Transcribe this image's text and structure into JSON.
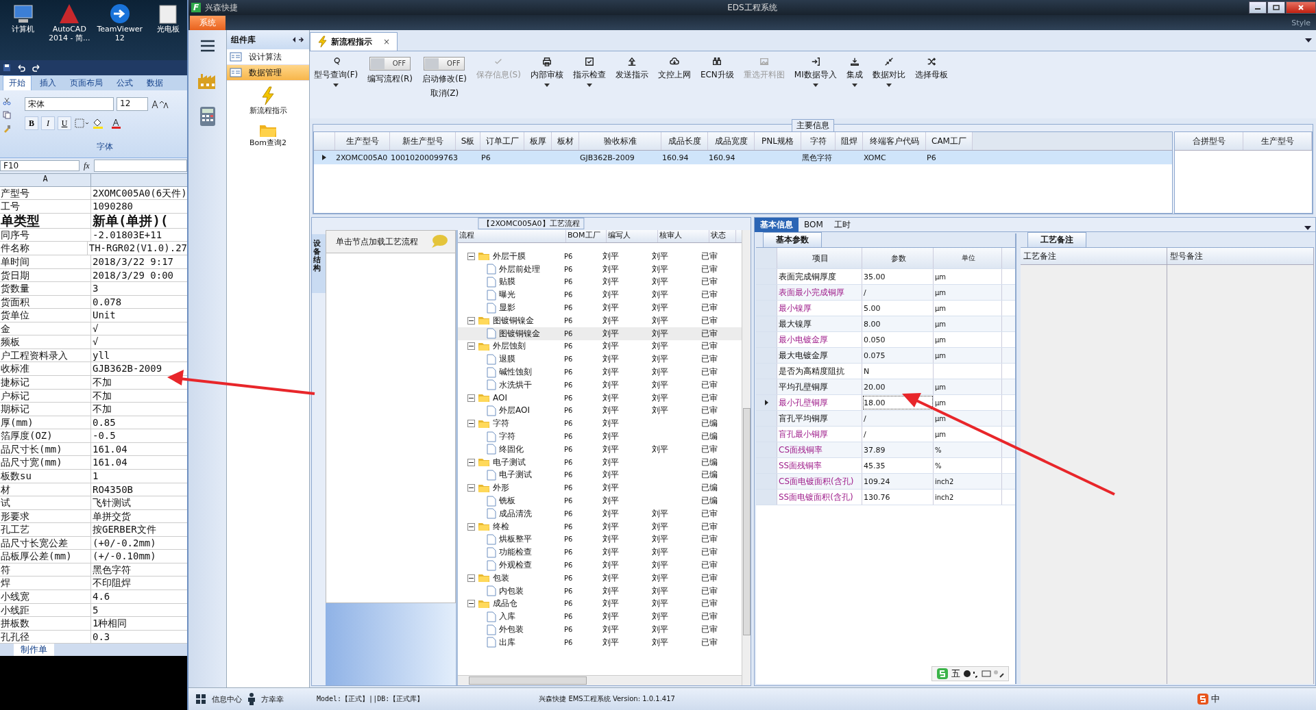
{
  "desktop": {
    "icons": [
      {
        "lines": [
          "计算机"
        ]
      },
      {
        "lines": [
          "AutoCAD",
          "2014 - 简..."
        ]
      },
      {
        "lines": [
          "TeamViewer",
          "12"
        ]
      },
      {
        "lines": [
          "光电板"
        ]
      }
    ]
  },
  "excel": {
    "tabs": [
      {
        "label": "开始",
        "selected": true
      },
      {
        "label": "插入",
        "selected": false
      },
      {
        "label": "页面布局",
        "selected": false
      },
      {
        "label": "公式",
        "selected": false
      },
      {
        "label": "数据",
        "selected": false
      }
    ],
    "font_name": "宋体",
    "font_size": "12",
    "format_buttons": [
      "B",
      "I",
      "U"
    ],
    "group_label": "字体",
    "name_box": "F10",
    "fx": "fx",
    "column": "A",
    "rows": [
      {
        "label": "产型号",
        "value": "2XOMC005A0(6天件)",
        "bold": false
      },
      {
        "label": "工号",
        "value": "1090280",
        "bold": false
      },
      {
        "label": "单类型",
        "value": "新单(单拼)(",
        "bold": true
      },
      {
        "label": "同序号",
        "value": "-2.01803E+11",
        "bold": false
      },
      {
        "label": "件名称",
        "value": "TH-RGR02(V1.0).27",
        "bold": false
      },
      {
        "label": "单时间",
        "value": "2018/3/22 9:17",
        "bold": false
      },
      {
        "label": "货日期",
        "value": "2018/3/29 0:00",
        "bold": false
      },
      {
        "label": "货数量",
        "value": "3",
        "bold": false
      },
      {
        "label": "货面积",
        "value": "0.078",
        "bold": false
      },
      {
        "label": "货单位",
        "value": "Unit",
        "bold": false
      },
      {
        "label": "金",
        "value": "√",
        "bold": false
      },
      {
        "label": "频板",
        "value": "√",
        "bold": false
      },
      {
        "label": "户工程资料录入",
        "value": "yll",
        "bold": false
      },
      {
        "label": "收标准",
        "value": "GJB362B-2009",
        "bold": false
      },
      {
        "label": "捷标记",
        "value": "不加",
        "bold": false
      },
      {
        "label": "户标记",
        "value": "不加",
        "bold": false
      },
      {
        "label": "期标记",
        "value": "不加",
        "bold": false
      },
      {
        "label": "厚(mm)",
        "value": "0.85",
        "bold": false
      },
      {
        "label": "箔厚度(OZ)",
        "value": "-0.5",
        "bold": false
      },
      {
        "label": "品尺寸长(mm)",
        "value": "161.04",
        "bold": false
      },
      {
        "label": "品尺寸宽(mm)",
        "value": "161.04",
        "bold": false
      },
      {
        "label": "板数su",
        "value": "1",
        "bold": false
      },
      {
        "label": "材",
        "value": "RO4350B",
        "bold": false
      },
      {
        "label": "试",
        "value": "飞针测试",
        "bold": false
      },
      {
        "label": "形要求",
        "value": "单拼交货",
        "bold": false
      },
      {
        "label": "孔工艺",
        "value": "按GERBER文件",
        "bold": false
      },
      {
        "label": "品尺寸长宽公差",
        "value": "(+0/-0.2mm)",
        "bold": false
      },
      {
        "label": "品板厚公差(mm)",
        "value": "(+/-0.10mm)",
        "bold": false
      },
      {
        "label": "符",
        "value": "黑色字符",
        "bold": false
      },
      {
        "label": "焊",
        "value": "不印阻焊",
        "bold": false
      },
      {
        "label": "小线宽",
        "value": "4.6",
        "bold": false
      },
      {
        "label": "小线距",
        "value": "5",
        "bold": false
      },
      {
        "label": "拼板数",
        "value": "1种相同",
        "bold": false
      },
      {
        "label": "孔孔径",
        "value": "0.3",
        "bold": false
      }
    ],
    "sheet_tab": "制作单"
  },
  "window": {
    "logo": "F",
    "company": "兴森快捷",
    "title": "EDS工程系统",
    "system_tab": "系统",
    "style_label": "Style"
  },
  "component_library": {
    "title": "组件库",
    "items": [
      {
        "label": "设计算法",
        "selected": false
      },
      {
        "label": "数据管理",
        "selected": true
      }
    ],
    "tools": [
      {
        "label": "新流程指示"
      },
      {
        "label": "Bom查询2"
      }
    ]
  },
  "document_tab": {
    "label": "新流程指示",
    "close": "×"
  },
  "toolbar": [
    {
      "kind": "button",
      "label": "型号查询(F)",
      "has_menu": true,
      "disabled": false
    },
    {
      "kind": "toggle",
      "label": "编写流程(R)",
      "toggle_text": "OFF",
      "on": false
    },
    {
      "kind": "toggle",
      "label": "启动修改(E)",
      "sublabel": "取消(Z)",
      "toggle_text": "OFF",
      "on": false
    },
    {
      "kind": "button",
      "label": "保存信息(S)",
      "has_menu": false,
      "disabled": true
    },
    {
      "kind": "button",
      "label": "内部审核",
      "has_menu": true,
      "disabled": false
    },
    {
      "kind": "button",
      "label": "指示检查",
      "has_menu": true,
      "disabled": false
    },
    {
      "kind": "button",
      "label": "发送指示",
      "has_menu": false,
      "disabled": false
    },
    {
      "kind": "button",
      "label": "文控上网",
      "has_menu": false,
      "disabled": false
    },
    {
      "kind": "button",
      "label": "ECN升级",
      "has_menu": false,
      "disabled": false
    },
    {
      "kind": "button",
      "label": "重选开料图",
      "has_menu": false,
      "disabled": true
    },
    {
      "kind": "button",
      "label": "MI数据导入",
      "has_menu": true,
      "disabled": false
    },
    {
      "kind": "button",
      "label": "集成",
      "has_menu": true,
      "disabled": false
    },
    {
      "kind": "button",
      "label": "数据对比",
      "has_menu": true,
      "disabled": false
    },
    {
      "kind": "button",
      "label": "选择母板",
      "has_menu": false,
      "disabled": false
    }
  ],
  "main_info": {
    "title": "主要信息",
    "columns": [
      "生产型号",
      "新生产型号",
      "S板",
      "订单工厂",
      "板厚",
      "板材",
      "验收标准",
      "成品长度",
      "成品宽度",
      "PNL规格",
      "字符",
      "阻焊",
      "终端客户代码",
      "CAM工厂"
    ],
    "rows": [
      {
        "cells": [
          "2XOMC005A0",
          "10010200099763",
          "",
          "P6",
          "",
          "",
          "GJB362B-2009",
          "160.94",
          "160.94",
          "",
          "黑色字符",
          "",
          "XOMC",
          "P6"
        ],
        "selected": true
      }
    ],
    "merge_columns": [
      "合拼型号",
      "生产型号"
    ]
  },
  "process": {
    "title": "【2XOMC005A0】工艺流程",
    "side_tab": "设备结构",
    "hint": "单击节点加载工艺流程",
    "columns": [
      "流程",
      "BOM工厂",
      "编写人",
      "核审人",
      "状态"
    ],
    "groups": [
      {
        "name": "外层干膜",
        "bom": "P6",
        "author": "刘平",
        "reviewer": "刘平",
        "status": "已审",
        "expanded": true,
        "selected": false,
        "children": [
          {
            "name": "外层前处理",
            "bom": "P6",
            "author": "刘平",
            "reviewer": "刘平",
            "status": "已审",
            "selected": false
          },
          {
            "name": "贴膜",
            "bom": "P6",
            "author": "刘平",
            "reviewer": "刘平",
            "status": "已审",
            "selected": false
          },
          {
            "name": "曝光",
            "bom": "P6",
            "author": "刘平",
            "reviewer": "刘平",
            "status": "已审",
            "selected": false
          },
          {
            "name": "显影",
            "bom": "P6",
            "author": "刘平",
            "reviewer": "刘平",
            "status": "已审",
            "selected": false
          }
        ]
      },
      {
        "name": "图镀铜镍金",
        "bom": "P6",
        "author": "刘平",
        "reviewer": "刘平",
        "status": "已审",
        "expanded": true,
        "selected": false,
        "children": [
          {
            "name": "图镀铜镍金",
            "bom": "P6",
            "author": "刘平",
            "reviewer": "刘平",
            "status": "已审",
            "selected": true
          }
        ]
      },
      {
        "name": "外层蚀刻",
        "bom": "P6",
        "author": "刘平",
        "reviewer": "刘平",
        "status": "已审",
        "expanded": true,
        "selected": false,
        "children": [
          {
            "name": "退膜",
            "bom": "P6",
            "author": "刘平",
            "reviewer": "刘平",
            "status": "已审",
            "selected": false
          },
          {
            "name": "碱性蚀刻",
            "bom": "P6",
            "author": "刘平",
            "reviewer": "刘平",
            "status": "已审",
            "selected": false
          },
          {
            "name": "水洗烘干",
            "bom": "P6",
            "author": "刘平",
            "reviewer": "刘平",
            "status": "已审",
            "selected": false
          }
        ]
      },
      {
        "name": "AOI",
        "bom": "P6",
        "author": "刘平",
        "reviewer": "刘平",
        "status": "已审",
        "expanded": true,
        "selected": false,
        "children": [
          {
            "name": "外层AOI",
            "bom": "P6",
            "author": "刘平",
            "reviewer": "刘平",
            "status": "已审",
            "selected": false
          }
        ]
      },
      {
        "name": "字符",
        "bom": "P6",
        "author": "刘平",
        "status": "已编",
        "expanded": true,
        "selected": false,
        "children": [
          {
            "name": "字符",
            "bom": "P6",
            "author": "刘平",
            "status": "已编",
            "selected": false
          },
          {
            "name": "终固化",
            "bom": "P6",
            "author": "刘平",
            "reviewer": "刘平",
            "status": "已审",
            "selected": false
          }
        ]
      },
      {
        "name": "电子测试",
        "bom": "P6",
        "author": "刘平",
        "status": "已编",
        "expanded": true,
        "selected": false,
        "children": [
          {
            "name": "电子测试",
            "bom": "P6",
            "author": "刘平",
            "status": "已编",
            "selected": false
          }
        ]
      },
      {
        "name": "外形",
        "bom": "P6",
        "author": "刘平",
        "status": "已编",
        "expanded": true,
        "selected": false,
        "children": [
          {
            "name": "铣板",
            "bom": "P6",
            "author": "刘平",
            "status": "已编",
            "selected": false
          },
          {
            "name": "成品清洗",
            "bom": "P6",
            "author": "刘平",
            "reviewer": "刘平",
            "status": "已审",
            "selected": false
          }
        ]
      },
      {
        "name": "终检",
        "bom": "P6",
        "author": "刘平",
        "reviewer": "刘平",
        "status": "已审",
        "expanded": true,
        "selected": false,
        "children": [
          {
            "name": "烘板整平",
            "bom": "P6",
            "author": "刘平",
            "reviewer": "刘平",
            "status": "已审",
            "selected": false
          },
          {
            "name": "功能检查",
            "bom": "P6",
            "author": "刘平",
            "reviewer": "刘平",
            "status": "已审",
            "selected": false
          },
          {
            "name": "外观检查",
            "bom": "P6",
            "author": "刘平",
            "reviewer": "刘平",
            "status": "已审",
            "selected": false
          }
        ]
      },
      {
        "name": "包装",
        "bom": "P6",
        "author": "刘平",
        "reviewer": "刘平",
        "status": "已审",
        "expanded": true,
        "selected": false,
        "children": [
          {
            "name": "内包装",
            "bom": "P6",
            "author": "刘平",
            "reviewer": "刘平",
            "status": "已审",
            "selected": false
          }
        ]
      },
      {
        "name": "成品仓",
        "bom": "P6",
        "author": "刘平",
        "reviewer": "刘平",
        "status": "已审",
        "expanded": true,
        "selected": false,
        "children": [
          {
            "name": "入库",
            "bom": "P6",
            "author": "刘平",
            "reviewer": "刘平",
            "status": "已审",
            "selected": false
          },
          {
            "name": "外包装",
            "bom": "P6",
            "author": "刘平",
            "reviewer": "刘平",
            "status": "已审",
            "selected": false
          },
          {
            "name": "出库",
            "bom": "P6",
            "author": "刘平",
            "reviewer": "刘平",
            "status": "已审",
            "selected": false
          }
        ]
      }
    ]
  },
  "detail_tabs": [
    {
      "label": "基本信息",
      "selected": true
    },
    {
      "label": "BOM",
      "selected": false
    },
    {
      "label": "工时",
      "selected": false
    }
  ],
  "basic_params": {
    "tab": "基本参数",
    "columns": [
      "项目",
      "参数",
      "单位"
    ],
    "rows": [
      {
        "item": "表面完成铜厚度",
        "value": "35.00",
        "unit": "μm",
        "highlight": false,
        "selected": false
      },
      {
        "item": "表面最小完成铜厚",
        "value": "/",
        "unit": "μm",
        "highlight": true,
        "selected": false
      },
      {
        "item": "最小镍厚",
        "value": "5.00",
        "unit": "μm",
        "highlight": true,
        "selected": false
      },
      {
        "item": "最大镍厚",
        "value": "8.00",
        "unit": "μm",
        "highlight": false,
        "selected": false
      },
      {
        "item": "最小电镀金厚",
        "value": "0.050",
        "unit": "μm",
        "highlight": true,
        "selected": false
      },
      {
        "item": "最大电镀金厚",
        "value": "0.075",
        "unit": "μm",
        "highlight": false,
        "selected": false
      },
      {
        "item": "是否为高精度阻抗",
        "value": "N",
        "highlight": false,
        "selected": false
      },
      {
        "item": "平均孔壁铜厚",
        "value": "20.00",
        "unit": "μm",
        "highlight": false,
        "selected": false
      },
      {
        "item": "最小孔壁铜厚",
        "value": "18.00",
        "unit": "μm",
        "highlight": true,
        "selected": true
      },
      {
        "item": "盲孔平均铜厚",
        "value": "/",
        "unit": "μm",
        "highlight": false,
        "selected": false
      },
      {
        "item": "盲孔最小铜厚",
        "value": "/",
        "unit": "μm",
        "highlight": true,
        "selected": false
      },
      {
        "item": "CS面残铜率",
        "value": "37.89",
        "unit": "%",
        "highlight": true,
        "selected": false
      },
      {
        "item": "SS面残铜率",
        "value": "45.35",
        "unit": "%",
        "highlight": true,
        "selected": false
      },
      {
        "item": "CS面电镀面积(含孔)",
        "value": "109.24",
        "unit": "inch2",
        "highlight": true,
        "selected": false
      },
      {
        "item": "SS面电镀面积(含孔)",
        "value": "130.76",
        "unit": "inch2",
        "highlight": true,
        "selected": false
      }
    ]
  },
  "remarks": {
    "tab": "工艺备注",
    "columns": [
      "工艺备注",
      "型号备注"
    ]
  },
  "ime_bar": {
    "mode": "五"
  },
  "status_bar": {
    "info_center": "信息中心",
    "user": "方幸幸",
    "model": "Model:【正式】||DB:【正式库】",
    "version": "兴森快捷  EMS工程系统  Version: 1.0.1.417",
    "tray_ime": "中"
  }
}
